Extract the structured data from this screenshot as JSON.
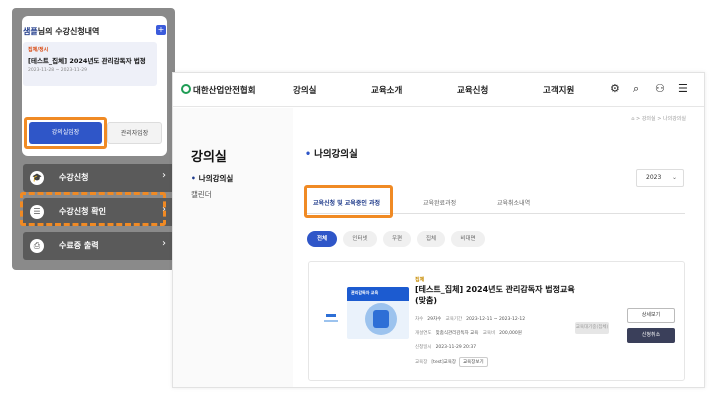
{
  "mobile": {
    "user_name": "샘플",
    "title_suffix": "님의 수강신청내역",
    "plus_label": "+",
    "course": {
      "tag": "집체/정시",
      "name": "[테스트_집체] 2024년도 관리감독자 법정",
      "date": "2023-11-28 ~ 2023-11-29"
    },
    "buttons": {
      "classroom": "강의실입장",
      "admin": "관리자입장"
    },
    "menu": [
      {
        "icon": "graduation-cap-icon",
        "glyph": "🎓",
        "label": "수강신청",
        "chevron": "›"
      },
      {
        "icon": "list-icon",
        "glyph": "☰",
        "label": "수강신청 확인",
        "chevron": "›"
      },
      {
        "icon": "printer-icon",
        "glyph": "⎙",
        "label": "수료증 출력",
        "chevron": "›"
      }
    ]
  },
  "desktop": {
    "logo": "대한산업안전협회",
    "nav": [
      "강의실",
      "교육소개",
      "교육신청",
      "고객지원"
    ],
    "icons": {
      "settings": "⚙",
      "search": "⌕",
      "user": "⚇",
      "menu": "☰"
    },
    "breadcrumb": "⌂ > 강의실 > 나의강의실",
    "page_title": "강의실",
    "sidebar": {
      "active": "나의강의실",
      "item": "캘린더"
    },
    "section_title": "나의강의실",
    "year": "2023",
    "tabs": [
      "교육신청 및 교육중인 과정",
      "교육완료과정",
      "교육취소내역"
    ],
    "chips": [
      "전체",
      "인터넷",
      "우편",
      "집체",
      "비대면"
    ],
    "course": {
      "tag": "집체",
      "title": "[테스트_집체] 2024년도 관리감독자 법정교육(맞춤)",
      "meta1_label": "차수",
      "meta1_value": "29차수",
      "meta1b_label": "교육기간",
      "meta1b_value": "2023-12-11 ~ 2023-12-12",
      "meta2_label": "개설연도",
      "meta2_value": "맞춤식관리감독자 교육",
      "meta2b_label": "교육비",
      "meta2b_value": "200,000원",
      "meta3_label": "신청일시",
      "meta3_value": "2023-11-29 20:37",
      "meta4_label": "교육장",
      "meta4_value": "[test]교육장",
      "meta4_button": "교육장보기",
      "status": "교육대기중(집체)",
      "detail_button": "상세보기",
      "cancel_button": "신청취소",
      "thumb_title": "관리감독자 교육"
    }
  }
}
